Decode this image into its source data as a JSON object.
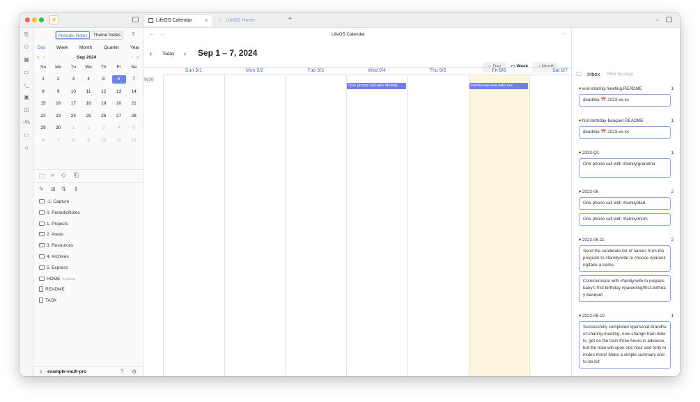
{
  "window": {
    "main_title": "LifeOS Calendar"
  },
  "tabs": [
    {
      "label": "LifeOS Calendar",
      "active": true
    },
    {
      "label": "LifeOS Home",
      "active": false
    }
  ],
  "left": {
    "note_tabs": [
      "Periodic Notes",
      "Theme Notes"
    ],
    "periods": [
      "Day",
      "Week",
      "Month",
      "Quarter",
      "Year"
    ],
    "month_label": "Sep  2024",
    "weekdays": [
      "Su",
      "Mo",
      "Tu",
      "We",
      "Th",
      "Fr",
      "Sa"
    ],
    "weeks": [
      [
        "1",
        "2",
        "3",
        "4",
        "5",
        "6",
        "7"
      ],
      [
        "8",
        "9",
        "10",
        "11",
        "12",
        "13",
        "14"
      ],
      [
        "15",
        "16",
        "17",
        "18",
        "19",
        "20",
        "21"
      ],
      [
        "22",
        "23",
        "24",
        "25",
        "26",
        "27",
        "28"
      ],
      [
        "29",
        "30",
        "1",
        "2",
        "3",
        "4",
        "5"
      ],
      [
        "6",
        "7",
        "8",
        "9",
        "10",
        "11",
        "12"
      ]
    ],
    "today": "6",
    "folders": [
      "-1. Capture",
      "0. PeriodicNotes",
      "1. Projects",
      "2. Areas",
      "3. Resources",
      "4. Archives",
      "5. Express"
    ],
    "home_label": "HOME",
    "home_badge": "CANVAS",
    "files": [
      "README",
      "TASK"
    ],
    "vault": "example-vault-pro"
  },
  "cal": {
    "today_btn": "Today",
    "range": "Sep 1 – 7, 2024",
    "views": [
      "Day",
      "Week",
      "Month"
    ],
    "days": [
      "Sun 9/1",
      "Mon 9/2",
      "Tue 9/3",
      "Wed 9/4",
      "Thu 9/5",
      "Fri 9/6",
      "Sat 9/7"
    ],
    "week_label": "W36",
    "events": [
      {
        "day": 3,
        "text": "One phone call with #family"
      },
      {
        "day": 5,
        "text": "#work/one-one with xxx"
      }
    ]
  },
  "inbox": {
    "title": "Inbox",
    "filter_placeholder": "Filter by page",
    "groups": [
      {
        "name": "wot-sharing-meeting.README",
        "count": "1",
        "cards": [
          "deadline 📅 2023-xx-xx"
        ]
      },
      {
        "name": "first-birthday-banquet.README",
        "count": "1",
        "cards": [
          "deadline 📅 2023-xx-xx"
        ]
      },
      {
        "name": "2023-Q1",
        "count": "1",
        "cards": [
          "One phone call with #family/grandma"
        ]
      },
      {
        "name": "2023-06",
        "count": "2",
        "cards": [
          "One phone call with #family/dad",
          "One phone call with #family/mom"
        ]
      },
      {
        "name": "2023-06-11",
        "count": "2",
        "cards": [
          "Send the candidate list of names from the program to #family/wife to choose #parenting/take-a-name",
          "Communicate with #family/wife to prepare baby's frist birthday #parenting/first-birthday-banquet"
        ]
      },
      {
        "name": "2023-06-10",
        "count": "1",
        "cards": [
          "Successfully completed #personal-brand/wot-sharing-meeting, now change train tickets, get on the train three hours in advance, but the train will open one hour and forty minutes more! Make a simple summary and to-do list"
        ]
      }
    ]
  },
  "colors": {
    "accent": "#4a6fd0",
    "today_fill": "#fdf6dc",
    "event": "#6c7ef0"
  }
}
